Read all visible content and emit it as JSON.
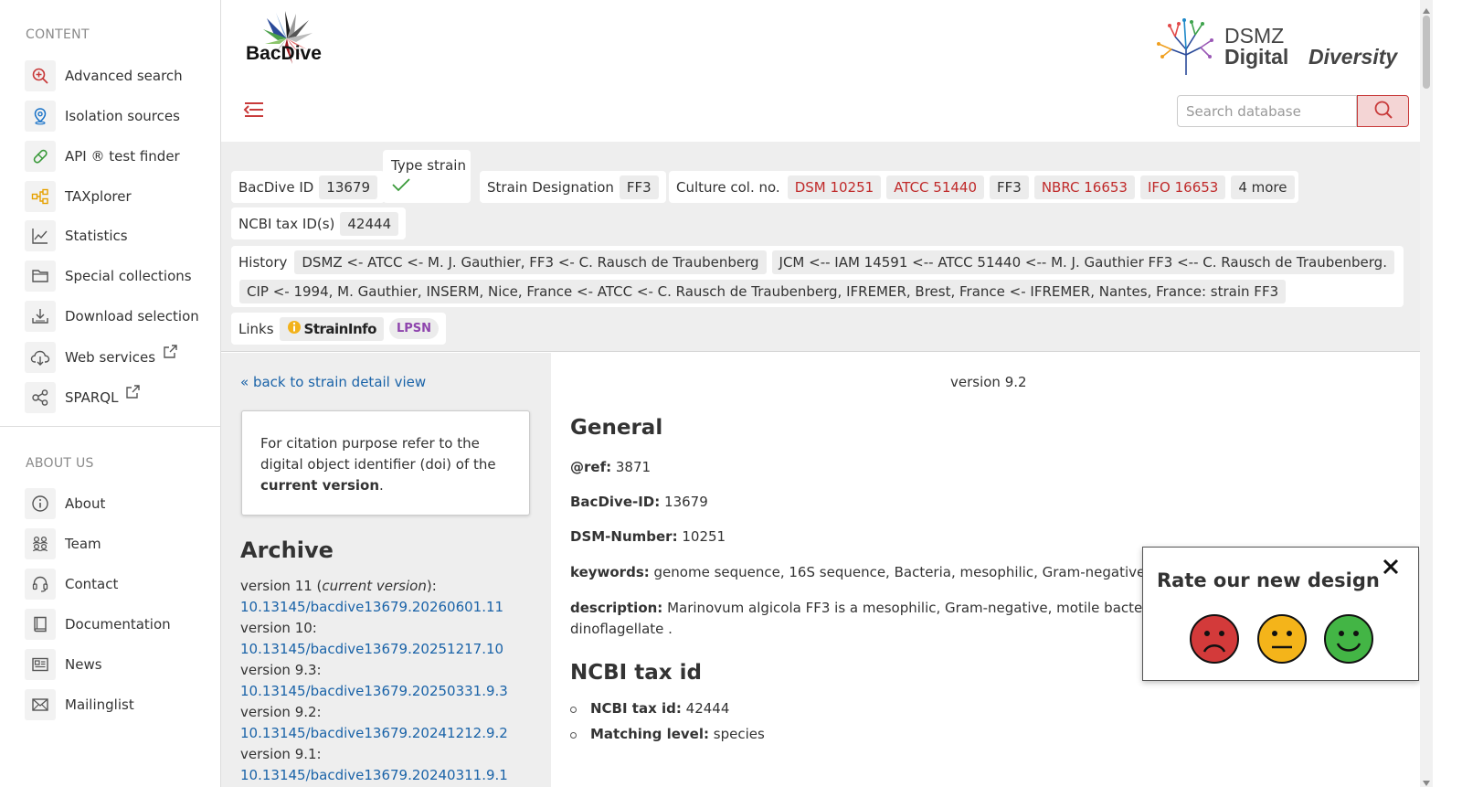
{
  "sidebar": {
    "content_title": "CONTENT",
    "items": [
      {
        "label": "Advanced search",
        "icon": "magnify-plus-icon"
      },
      {
        "label": "Isolation sources",
        "icon": "map-pin-icon"
      },
      {
        "label": "API ® test finder",
        "icon": "pill-icon"
      },
      {
        "label": "TAXplorer",
        "icon": "tree-structure-icon"
      },
      {
        "label": "Statistics",
        "icon": "line-chart-icon"
      },
      {
        "label": "Special collections",
        "icon": "folder-icon"
      },
      {
        "label": "Download selection",
        "icon": "download-icon"
      },
      {
        "label": "Web services",
        "icon": "cloud-download-icon"
      },
      {
        "label": "SPARQL",
        "icon": "share-graph-icon"
      }
    ],
    "about_title": "ABOUT US",
    "about_items": [
      {
        "label": "About",
        "icon": "info-icon"
      },
      {
        "label": "Team",
        "icon": "team-icon"
      },
      {
        "label": "Contact",
        "icon": "headset-icon"
      },
      {
        "label": "Documentation",
        "icon": "book-icon"
      },
      {
        "label": "News",
        "icon": "newspaper-icon"
      },
      {
        "label": "Mailinglist",
        "icon": "mail-icon"
      }
    ]
  },
  "header": {
    "logo_text": "BacDive",
    "dsmz_line1": "DSMZ",
    "dsmz_line2a": "Digital",
    "dsmz_line2b": "Diversity",
    "search_placeholder": "Search database"
  },
  "strain": {
    "bacdive_id_label": "BacDive ID",
    "bacdive_id": "13679",
    "type_strain_label": "Type strain",
    "designation_label": "Strain Designation",
    "designation": "FF3",
    "culture_label": "Culture col. no.",
    "culture_chips": [
      "DSM 10251",
      "ATCC 51440",
      "FF3",
      "NBRC 16653",
      "IFO 16653",
      "4 more"
    ],
    "ncbi_label": "NCBI tax ID(s)",
    "ncbi_id": "42444",
    "history_label": "History",
    "history": [
      "DSMZ <- ATCC <- M. J. Gauthier, FF3 <- C. Rausch de Traubenberg",
      "JCM <-- IAM 14591 <-- ATCC 51440 <-- M. J. Gauthier FF3 <-- C. Rausch de Traubenberg.",
      "CIP <- 1994, M. Gauthier, INSERM, Nice, France <- ATCC <- C. Rausch de Traubenberg, IFREMER, Brest, France <- IFREMER, Nantes, France: strain FF3"
    ],
    "links_label": "Links",
    "link_straininfo": "StrainInfo",
    "link_lpsn": "LPSN"
  },
  "archive": {
    "back_link": "« back to strain detail view",
    "cite_text_1": "For citation purpose refer to the digital object identifier (doi) of the ",
    "cite_text_bold": "current version",
    "cite_text_2": ".",
    "title": "Archive",
    "v11_label": "version 11 (",
    "v11_current": "current version",
    "v11_end": "):",
    "v11_link": "10.13145/bacdive13679.20260601.11",
    "v10_label": "version 10:",
    "v10_link": "10.13145/bacdive13679.20251217.10",
    "v93_label": "version 9.3:",
    "v93_link": "10.13145/bacdive13679.20250331.9.3",
    "v92_label": "version 9.2:",
    "v92_link": "10.13145/bacdive13679.20241212.9.2",
    "v91_label": "version 9.1:",
    "v91_link": "10.13145/bacdive13679.20240311.9.1"
  },
  "main": {
    "version": "version 9.2",
    "general_title": "General",
    "ref_label": "@ref:",
    "ref_value": "3871",
    "bacdive_label": "BacDive-ID:",
    "bacdive_value": "13679",
    "dsm_label": "DSM-Number:",
    "dsm_value": "10251",
    "keywords_label": "keywords:",
    "keywords_value": "genome sequence, 16S sequence, Bacteria, mesophilic, Gram-negative, motile",
    "desc_label": "description:",
    "desc_value": "Marinovum algicola FF3 is a mesophilic, Gram-negative, motile bacterium that was isolated from",
    "desc_line2": "dinoflagellate .",
    "ncbi_title": "NCBI tax id",
    "ncbi_field_label": "NCBI tax id:",
    "ncbi_field_value": "42444",
    "matching_label": "Matching level:",
    "matching_value": "species"
  },
  "rating": {
    "title": "Rate our new design",
    "faces": [
      "sad-face-icon",
      "neutral-face-icon",
      "happy-face-icon"
    ]
  },
  "colors": {
    "accent_red": "#c83a3a",
    "link_blue": "#1a63a8",
    "band_gray": "#eeeeee"
  }
}
